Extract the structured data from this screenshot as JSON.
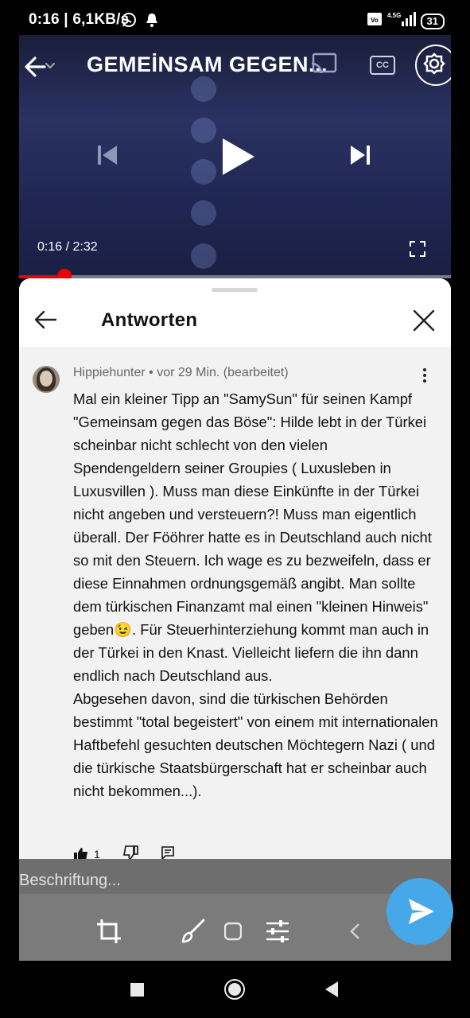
{
  "status_bar": {
    "time": "0:16",
    "speed": "6,1KB/s",
    "network": "4.5G",
    "battery": "31",
    "icons": [
      "whatsapp-icon",
      "bell-icon",
      "volte-icon",
      "signal-icon",
      "battery-icon"
    ]
  },
  "video": {
    "title": "GEMEİNSAM GEGEN...",
    "current_time": "0:16",
    "duration": "2:32",
    "time_display": "0:16 / 2:32",
    "progress": 0.105,
    "cc_label": "CC"
  },
  "sheet": {
    "title": "Antworten",
    "comment": {
      "author": "Hippiehunter",
      "time": "vor 29 Min. (bearbeitet)",
      "meta": "Hippiehunter • vor 29 Min. (bearbeitet)",
      "paragraph1": "Mal ein kleiner Tipp an \"SamySun\" für seinen Kampf \"Gemeinsam gegen das Böse\": Hilde lebt in der Türkei scheinbar nicht schlecht von den vielen Spendengeldern seiner Groupies ( Luxusleben in Luxusvillen ). Muss man diese Einkünfte in der Türkei nicht angeben und versteuern?! Muss man eigentlich überall. Der Fööhrer hatte es in Deutschland auch nicht so mit den Steuern. Ich wage es zu bezweifeln, dass er diese Einnahmen ordnungsgemäß angibt. Man sollte dem türkischen Finanzamt mal einen \"kleinen Hinweis\" geben😉. Für Steuerhinterziehung kommt man auch in der Türkei in den Knast. Vielleicht liefern die ihn dann endlich nach Deutschland aus.",
      "paragraph2": "Abgesehen davon, sind die türkischen Behörden bestimmt \"total begeistert\" von einem mit internationalen Haftbefehl gesuchten deutschen Möchtegern Nazi ( und die türkische Staatsbürgerschaft hat er scheinbar auch nicht bekommen...).",
      "likes": "1"
    }
  },
  "editor": {
    "caption_placeholder": "Beschriftung..."
  },
  "colors": {
    "progress_red": "#e00000",
    "send_blue": "#46a8e8",
    "sheet_bg": "#ffffff",
    "comment_bg": "#f2f2f2"
  }
}
